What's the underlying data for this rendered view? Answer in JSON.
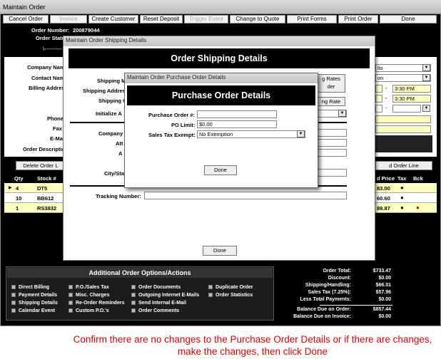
{
  "window_title": "Maintain  Order",
  "toolbar": [
    "Cancel Order",
    "Invoice",
    "Create Customer",
    "Reset Deposit",
    "Trigger Event",
    "Change to Quote",
    "Print Forms",
    "Print Order",
    "Done"
  ],
  "order": {
    "number_label": "Order Number:",
    "number": "200879044",
    "status_label": "Order Status:",
    "status_dash": "\\----------"
  },
  "customer_labels": {
    "company": "Company Name",
    "contact": "Contact Name",
    "billing": "Billing Address",
    "phone": "Phone",
    "fax": "Fax",
    "email": "E-Mail",
    "desc": "Order Description"
  },
  "right_fields": {
    "company_tail": "lio",
    "contact_tail": "on",
    "time1": "3:30 PM",
    "time2": "3:30 PM"
  },
  "items": {
    "delete_label": "Delete Order L",
    "add_label": "d Order Line",
    "headers": {
      "qty": "Qty",
      "stock": "Stock #",
      "price": "d Price",
      "tax": "Tax",
      "bck": "Bck"
    },
    "rows": [
      {
        "qty": "4",
        "stock": "DT5",
        "price": "83.00",
        "tax": "●",
        "bck": ""
      },
      {
        "qty": "10",
        "stock": "BB612",
        "price": "60.60",
        "tax": "●",
        "bck": ""
      },
      {
        "qty": "1",
        "stock": "RS3832",
        "price": "89.87",
        "tax": "●",
        "bck": "●"
      }
    ]
  },
  "shipping_dialog": {
    "title": "Maintain Order Shipping Details",
    "header": "Order Shipping Details",
    "labels": {
      "method": "Shipping M",
      "address": "Shipping Addres",
      "cost": "Shipping C",
      "initialize": "Initialize A",
      "company": "Company",
      "attn": "Att",
      "addr": "A",
      "citystate": "City/Sta",
      "tracking": "Tracking Number:"
    },
    "rates_btn": "g Rates\nder",
    "rate_btn": "ng Rate",
    "done": "Done"
  },
  "po_dialog": {
    "title": "Maintain Order Purchase Order Details",
    "header": "Purchase Order Details",
    "po_label": "Purchase Order #:",
    "po_value": "",
    "limit_label": "PO Limit:",
    "limit_value": "$0.00",
    "tax_label": "Sales Tax Exempt:",
    "tax_value": "No Exemption",
    "done": "Done"
  },
  "options": {
    "header": "Additional Order Options/Actions",
    "col1": [
      "Direct Billing",
      "Payment Details",
      "Shipping Details",
      "Calendar Event"
    ],
    "col2": [
      "P.O./Sales Tax",
      "Misc. Charges",
      "Re-Order Reminders",
      "Custom P.O.'s"
    ],
    "col3": [
      "Order Documents",
      "Outgoing Internet E-Mails",
      "Send Internal E-Mail",
      "Order Comments"
    ],
    "col4": [
      "Duplicate Order",
      "Order Statistics"
    ]
  },
  "totals": [
    {
      "label": "Order Total:",
      "value": "$733.47"
    },
    {
      "label": "Discount:",
      "value": "$0.00"
    },
    {
      "label": "Shipping/Handling:",
      "value": "$66.01"
    },
    {
      "label": "Sales Tax (7.25%):",
      "value": "$57.96"
    },
    {
      "label": "Less Total Payments:",
      "value": "$0.00"
    },
    {
      "label": "Balance Due on Order:",
      "value": "$857.44"
    },
    {
      "label": "Balance Due on Invoice:",
      "value": "$0.00"
    }
  ],
  "caption": "Confirm there are no changes to the Purchase Order Details or if there are changes, make the changes, then click Done",
  "colors": {
    "caption": "#e00000",
    "row_bg": "#ffffc0",
    "dot_red": "#e00000"
  }
}
